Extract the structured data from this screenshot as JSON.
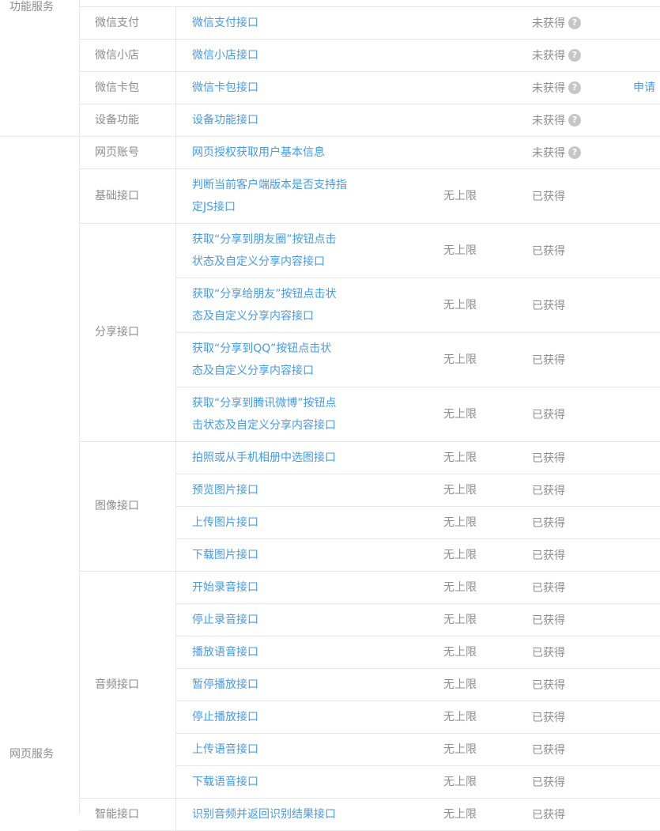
{
  "categories": {
    "func": "功能服务",
    "web": "网页服务"
  },
  "help_icon": "?",
  "func_rows": [
    {
      "sub": "微信支付",
      "link": "微信支付接口",
      "status": "未获得",
      "help": true
    },
    {
      "sub": "微信小店",
      "link": "微信小店接口",
      "status": "未获得",
      "help": true
    },
    {
      "sub": "微信卡包",
      "link": "微信卡包接口",
      "status": "未获得",
      "help": true,
      "action": "申请"
    },
    {
      "sub": "设备功能",
      "link": "设备功能接口",
      "status": "未获得",
      "help": true
    }
  ],
  "web_account": {
    "sub": "网页账号",
    "link": "网页授权获取用户基本信息",
    "status": "未获得",
    "help": true
  },
  "web_groups": [
    {
      "sub": "基础接口",
      "items": [
        {
          "lines": [
            "判断当前客户端版本是否支持指",
            "定JS接口"
          ],
          "limit": "无上限",
          "status": "已获得"
        }
      ]
    },
    {
      "sub": "分享接口",
      "items": [
        {
          "lines": [
            "获取“分享到朋友圈”按钮点击",
            "状态及自定义分享内容接口"
          ],
          "limit": "无上限",
          "status": "已获得"
        },
        {
          "lines": [
            "获取“分享给朋友”按钮点击状",
            "态及自定义分享内容接口"
          ],
          "limit": "无上限",
          "status": "已获得"
        },
        {
          "lines": [
            "获取“分享到QQ”按钮点击状",
            "态及自定义分享内容接口"
          ],
          "limit": "无上限",
          "status": "已获得"
        },
        {
          "lines": [
            "获取“分享到腾讯微博”按钮点",
            "击状态及自定义分享内容接口"
          ],
          "limit": "无上限",
          "status": "已获得"
        }
      ]
    },
    {
      "sub": "图像接口",
      "items": [
        {
          "lines": [
            "拍照或从手机相册中选图接口"
          ],
          "limit": "无上限",
          "status": "已获得"
        },
        {
          "lines": [
            "预览图片接口"
          ],
          "limit": "无上限",
          "status": "已获得"
        },
        {
          "lines": [
            "上传图片接口"
          ],
          "limit": "无上限",
          "status": "已获得"
        },
        {
          "lines": [
            "下载图片接口"
          ],
          "limit": "无上限",
          "status": "已获得"
        }
      ]
    },
    {
      "sub": "音频接口",
      "items": [
        {
          "lines": [
            "开始录音接口"
          ],
          "limit": "无上限",
          "status": "已获得"
        },
        {
          "lines": [
            "停止录音接口"
          ],
          "limit": "无上限",
          "status": "已获得"
        },
        {
          "lines": [
            "播放语音接口"
          ],
          "limit": "无上限",
          "status": "已获得"
        },
        {
          "lines": [
            "暂停播放接口"
          ],
          "limit": "无上限",
          "status": "已获得"
        },
        {
          "lines": [
            "停止播放接口"
          ],
          "limit": "无上限",
          "status": "已获得"
        },
        {
          "lines": [
            "上传语音接口"
          ],
          "limit": "无上限",
          "status": "已获得"
        },
        {
          "lines": [
            "下载语音接口"
          ],
          "limit": "无上限",
          "status": "已获得"
        }
      ]
    },
    {
      "sub": "智能接口",
      "items": [
        {
          "lines": [
            "识别音频并返回识别结果接口"
          ],
          "limit": "无上限",
          "status": "已获得"
        }
      ]
    }
  ]
}
